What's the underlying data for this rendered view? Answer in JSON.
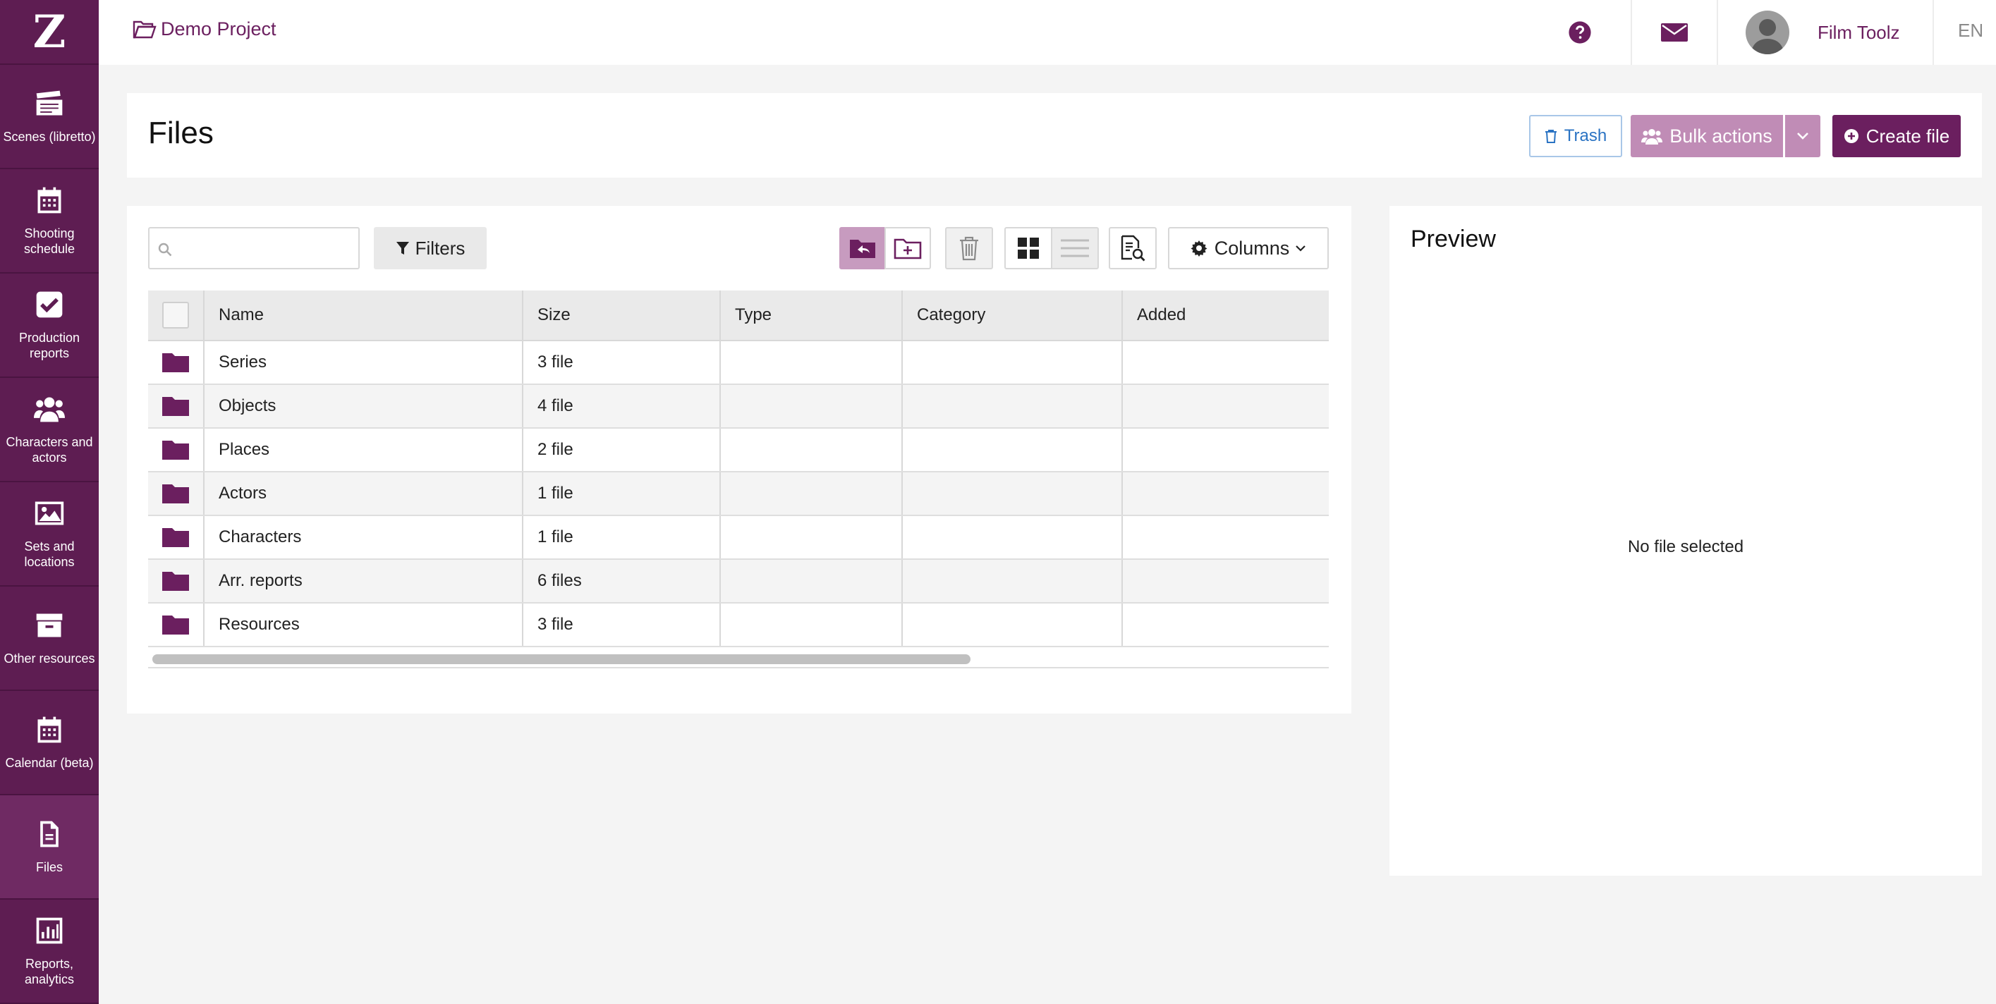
{
  "app": {
    "logo_letter": "Z",
    "brand_color": "#5e1d52",
    "accent_color": "#6b1f5f"
  },
  "sidebar": {
    "items": [
      {
        "label": "Scenes (libretto)",
        "icon": "clapperboard-icon"
      },
      {
        "label": "Shooting schedule",
        "icon": "calendar-icon"
      },
      {
        "label": "Production reports",
        "icon": "checkbox-icon"
      },
      {
        "label": "Characters and actors",
        "icon": "users-icon"
      },
      {
        "label": "Sets and locations",
        "icon": "image-icon"
      },
      {
        "label": "Other resources",
        "icon": "archive-box-icon"
      },
      {
        "label": "Calendar (beta)",
        "icon": "calendar-icon"
      },
      {
        "label": "Files",
        "icon": "file-icon",
        "active": true
      },
      {
        "label": "Reports, analytics",
        "icon": "bar-chart-icon"
      }
    ]
  },
  "topbar": {
    "project_name": "Demo Project",
    "user_name": "Film Toolz",
    "language": "EN"
  },
  "header": {
    "title": "Files",
    "trash_label": "Trash",
    "bulk_label": "Bulk actions",
    "create_label": "Create file"
  },
  "toolbar": {
    "search_placeholder": "",
    "filters_label": "Filters",
    "columns_label": "Columns"
  },
  "table": {
    "columns": [
      "Name",
      "Size",
      "Type",
      "Category",
      "Added"
    ],
    "rows": [
      {
        "name": "Series",
        "size": "3 file",
        "type": "",
        "category": "",
        "added": ""
      },
      {
        "name": "Objects",
        "size": "4 file",
        "type": "",
        "category": "",
        "added": ""
      },
      {
        "name": "Places",
        "size": "2 file",
        "type": "",
        "category": "",
        "added": ""
      },
      {
        "name": "Actors",
        "size": "1 file",
        "type": "",
        "category": "",
        "added": ""
      },
      {
        "name": "Characters",
        "size": "1 file",
        "type": "",
        "category": "",
        "added": ""
      },
      {
        "name": "Arr. reports",
        "size": "6 files",
        "type": "",
        "category": "",
        "added": ""
      },
      {
        "name": "Resources",
        "size": "3 file",
        "type": "",
        "category": "",
        "added": ""
      }
    ]
  },
  "preview": {
    "title": "Preview",
    "empty_text": "No file selected"
  }
}
